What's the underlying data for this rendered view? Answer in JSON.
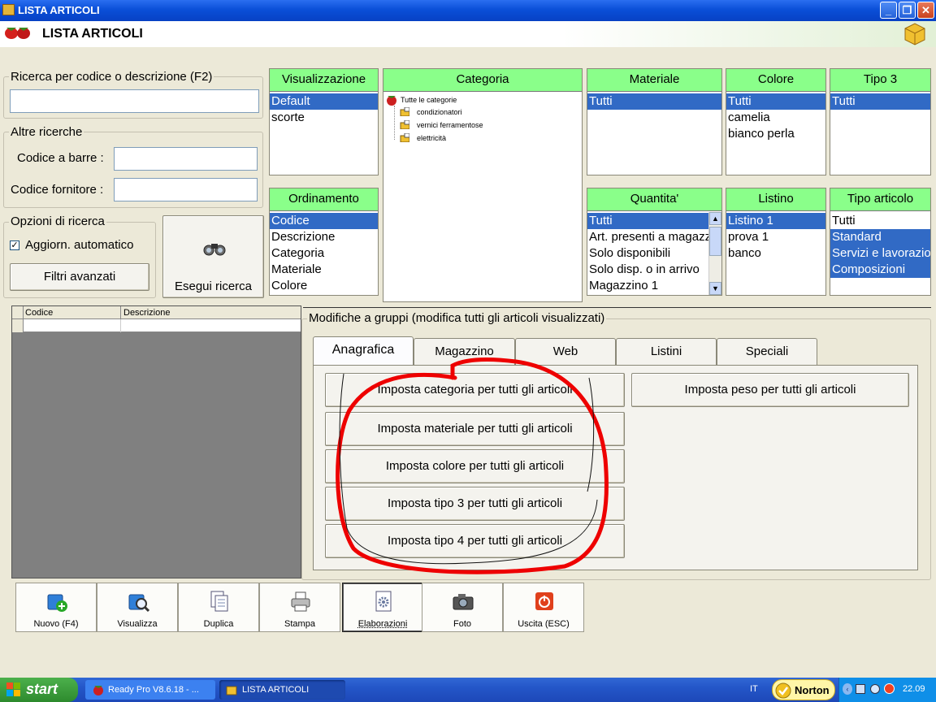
{
  "window": {
    "title": "LISTA ARTICOLI",
    "header_title": "LISTA ARTICOLI"
  },
  "search": {
    "group_label": "Ricerca per codice o descrizione (F2)",
    "value": "",
    "other_group_label": "Altre ricerche",
    "barcode_label": "Codice a barre :",
    "supplier_code_label": "Codice fornitore :",
    "options_group_label": "Opzioni di ricerca",
    "auto_update_label": "Aggiorn. automatico",
    "auto_update_checked": true,
    "advanced_filters_label": "Filtri avanzati",
    "run_search_label": "Esegui ricerca"
  },
  "lists": {
    "visualizzazione": {
      "header": "Visualizzazione",
      "items": [
        "Default",
        "scorte"
      ],
      "selected": 0
    },
    "ordinamento": {
      "header": "Ordinamento",
      "items": [
        "Codice",
        "Descrizione",
        "Categoria",
        "Materiale",
        "Colore"
      ],
      "selected": 0
    },
    "categoria": {
      "header": "Categoria",
      "root": "Tutte le categorie",
      "children": [
        "condizionatori",
        "vernici ferramentose",
        "elettricità"
      ]
    },
    "materiale": {
      "header": "Materiale",
      "items": [
        "Tutti"
      ],
      "selected": 0
    },
    "colore": {
      "header": "Colore",
      "items": [
        "Tutti",
        "camelia",
        "bianco perla"
      ],
      "selected": 0
    },
    "tipo3": {
      "header": "Tipo 3",
      "items": [
        "Tutti"
      ],
      "selected": 0
    },
    "quantita": {
      "header": "Quantita'",
      "items": [
        "Tutti",
        "Art. presenti a magazz",
        "Solo disponibili",
        "Solo disp. o in arrivo",
        "Magazzino 1"
      ],
      "selected": 0
    },
    "listino": {
      "header": "Listino",
      "items": [
        "Listino 1",
        "prova 1",
        "banco"
      ],
      "selected": 0
    },
    "tipo_articolo": {
      "header": "Tipo articolo",
      "items": [
        "Tutti",
        "Standard",
        "Servizi e lavorazioni",
        "Composizioni"
      ],
      "selected_multi": [
        1,
        2,
        3
      ]
    }
  },
  "grid": {
    "columns": [
      "Codice",
      "Descrizione"
    ]
  },
  "group_edit": {
    "label": "Modifiche a gruppi (modifica tutti gli articoli visualizzati)",
    "tabs": [
      "Anagrafica",
      "Magazzino",
      "Web",
      "Listini",
      "Speciali"
    ],
    "active_tab": 0,
    "buttons": [
      "Imposta categoria per tutti gli articoli",
      "Imposta materiale per tutti gli articoli",
      "Imposta colore per tutti gli articoli",
      "Imposta tipo 3 per tutti gli articoli",
      "Imposta tipo 4 per tutti gli articoli",
      "Imposta peso per tutti gli articoli"
    ]
  },
  "toolbar": [
    {
      "label": "Nuovo (F4)",
      "icon": "new-icon"
    },
    {
      "label": "Visualizza",
      "icon": "view-icon"
    },
    {
      "label": "Duplica",
      "icon": "duplicate-icon"
    },
    {
      "label": "Stampa",
      "icon": "printer-icon"
    },
    {
      "label": "Elaborazioni",
      "icon": "gear-doc-icon"
    },
    {
      "label": "Foto",
      "icon": "camera-icon"
    },
    {
      "label": "Uscita (ESC)",
      "icon": "power-icon"
    }
  ],
  "taskbar": {
    "start": "start",
    "tasks": [
      "Ready Pro V8.6.18 - ...",
      "LISTA ARTICOLI"
    ],
    "lang": "IT",
    "norton": "Norton",
    "time": "22.09"
  },
  "colors": {
    "list_header": "#8aff8a",
    "selection": "#316ac5",
    "annotation": "#ee0000"
  }
}
